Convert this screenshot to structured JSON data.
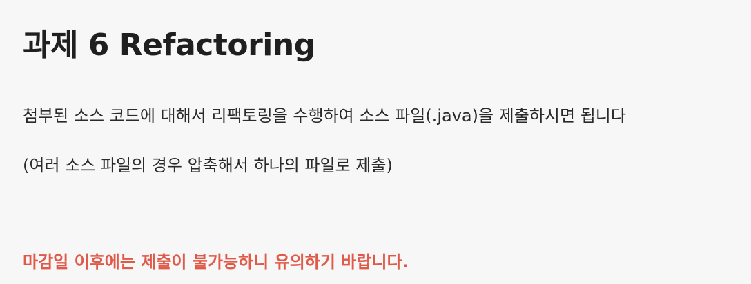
{
  "assignment": {
    "title": "과제 6 Refactoring",
    "description_line1": "첨부된 소스 코드에 대해서 리팩토링을 수행하여 소스 파일(.java)을 제출하시면 됩니다",
    "description_line2": "(여러 소스 파일의 경우 압축해서 하나의 파일로 제출)",
    "deadline_notice": "마감일 이후에는 제출이 불가능하니 유의하기 바랍니다.",
    "colors": {
      "background": "#f7f7f7",
      "text": "#222222",
      "warning": "#e05a4a"
    }
  }
}
